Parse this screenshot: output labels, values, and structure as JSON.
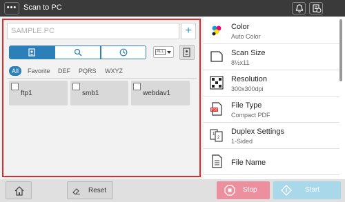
{
  "header": {
    "menu_label": "•••",
    "title": "Scan to PC"
  },
  "address": {
    "search_placeholder": "SAMPLE.PC",
    "add_label": "+",
    "type_dropdown_label": "ALL",
    "filters": [
      "All",
      "Favorite",
      "DEF",
      "PQRS",
      "WXYZ"
    ],
    "active_filter": "All",
    "destinations": [
      "ftp1",
      "smb1",
      "webdav1"
    ]
  },
  "functions": [
    {
      "name": "Color",
      "value": "Auto Color",
      "icon": "color-icon"
    },
    {
      "name": "Scan Size",
      "value": "8½x11",
      "icon": "scan-size-icon"
    },
    {
      "name": "Resolution",
      "value": "300x300dpi",
      "icon": "resolution-icon"
    },
    {
      "name": "File Type",
      "value": "Compact PDF",
      "icon": "pdf-file-icon"
    },
    {
      "name": "Duplex Settings",
      "value": "1-Sided",
      "icon": "duplex-icon"
    },
    {
      "name": "File Name",
      "value": "",
      "icon": "document-icon"
    }
  ],
  "footer": {
    "reset_label": "Reset",
    "stop_label": "Stop",
    "start_label": "Start"
  },
  "colors": {
    "accent": "#2c7fb8",
    "highlight_frame": "#e12b2b",
    "stop": "#ec8f9f",
    "start": "#a9d8ea"
  }
}
